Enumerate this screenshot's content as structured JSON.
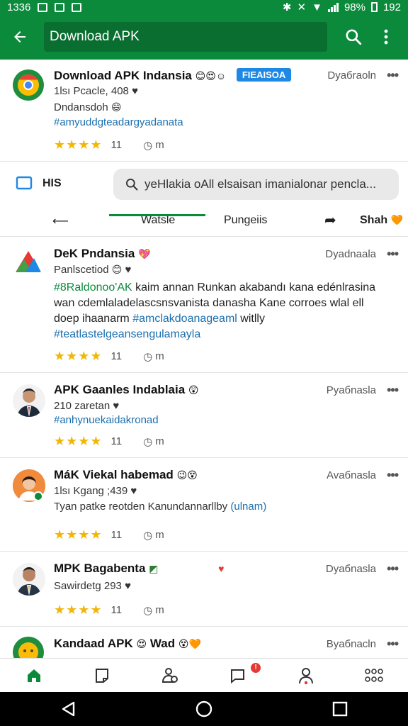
{
  "status": {
    "time": "1336",
    "battery": "98%",
    "extra": "192"
  },
  "appbar": {
    "search_text": "Download APK"
  },
  "posts": [
    {
      "name": "Download APK Indansia",
      "badge": "FIEAISOA",
      "right": "Dyaбraoln",
      "meta": "1lsı Pcacle, 408",
      "line2": "Dndansdoh",
      "hashtag": "#amyuddgteadargyadanata",
      "count": "11",
      "time": "m"
    },
    {
      "name": "DeK Pndansia",
      "right": "Dyadnaala",
      "meta": "Panlscetiod",
      "body_tag": "#8Raldonoo'AK",
      "body1": " kaim annan Runkan akabandı kana edénlrasina wan cdemlaladelascsnsvanista danasha Kane corroes wlal ell doep ihaanarm ",
      "body_tag2": "#amclakdoanageaml",
      "body2": " witlly",
      "body_tag3": "#teatlastelgeansengulamayla",
      "count": "11",
      "time": "m"
    },
    {
      "name": "APK Gaanles Indablaia",
      "right": "Pyaбnasla",
      "meta": "210 zaretan",
      "hashtag": "#anhynuekaidakronad",
      "count": "11",
      "time": "m"
    },
    {
      "name": "MáK Viekal habemad",
      "right": "Avaбnasla",
      "meta": "1lsı Kgang ;439",
      "body": "Tyan patke reotden Kanundannarllby ",
      "body_tag": "(ulnam)",
      "count": "11",
      "time": "m"
    },
    {
      "name": "MPK Bagabenta",
      "right": "Dyaбnasla",
      "meta": "Sawirdetg 293",
      "count": "11",
      "time": "m"
    },
    {
      "name": "Kandaad APK",
      "name2": "Wad",
      "right": "Byaбnacln"
    }
  ],
  "strip": {
    "his_label": "HIS",
    "search_text": "yeНlakia oAll elsaisan imanialonar pencla..."
  },
  "tabs": {
    "t1": "Watsle",
    "t2": "Pungeiis",
    "t3": "Shah"
  },
  "nav_badge": "!",
  "icons": [
    "back-arrow-icon",
    "search-icon",
    "kebab-icon",
    "home-icon",
    "bookmark-icon",
    "contacts-icon",
    "chat-icon",
    "profile-icon",
    "apps-icon"
  ],
  "colors": {
    "brand_green": "#0b8a3c",
    "star": "#f2b705",
    "badge_blue": "#1e88e5",
    "link_blue": "#1a6fae"
  }
}
